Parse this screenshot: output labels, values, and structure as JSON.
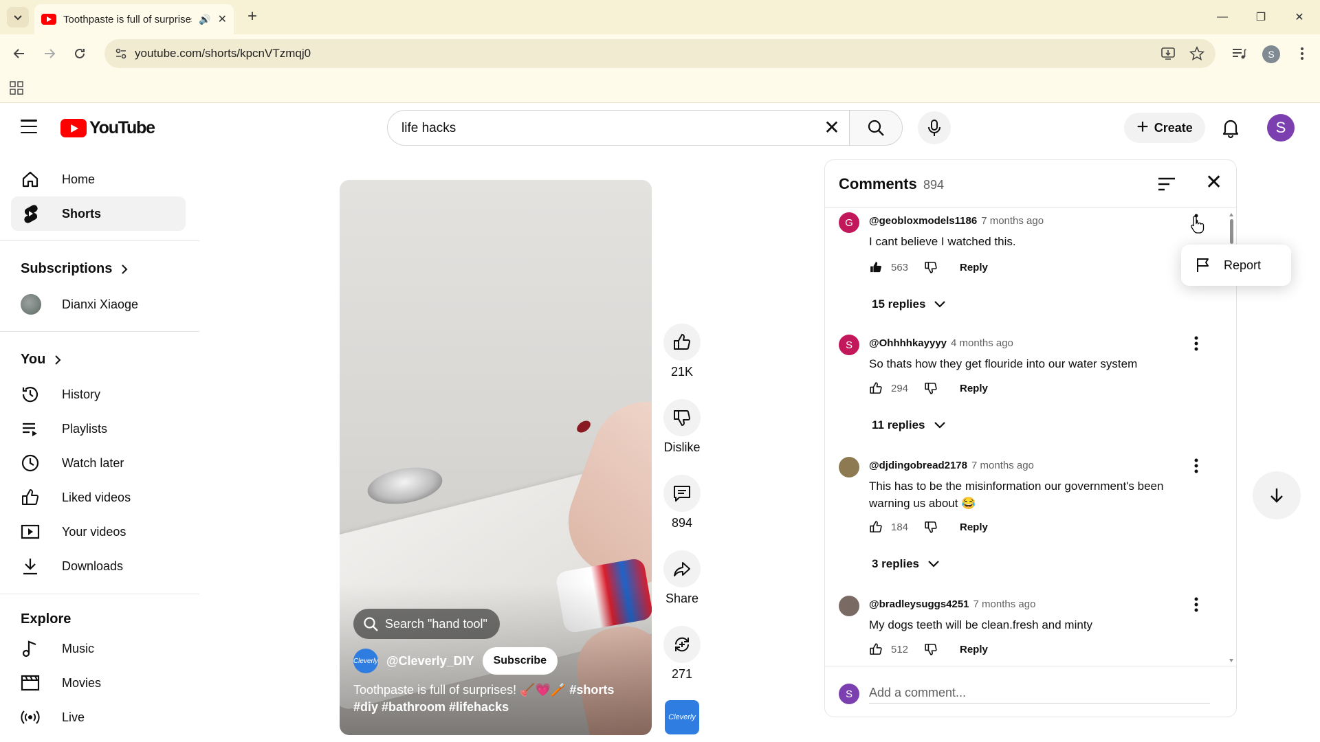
{
  "browser": {
    "tab_title": "Toothpaste is full of surprises",
    "url": "youtube.com/shorts/kpcnVTzmqj0",
    "profile_initial": "S"
  },
  "header": {
    "brand": "YouTube",
    "search_query": "life hacks",
    "create_label": "Create",
    "user_initial": "S"
  },
  "sidebar": {
    "main": [
      {
        "label": "Home",
        "icon": "home-icon"
      },
      {
        "label": "Shorts",
        "icon": "shorts-icon",
        "active": true
      }
    ],
    "subscriptions_heading": "Subscriptions",
    "subscriptions": [
      {
        "label": "Dianxi Xiaoge"
      }
    ],
    "you_heading": "You",
    "you": [
      {
        "label": "History",
        "icon": "history-icon"
      },
      {
        "label": "Playlists",
        "icon": "playlists-icon"
      },
      {
        "label": "Watch later",
        "icon": "clock-icon"
      },
      {
        "label": "Liked videos",
        "icon": "thumbs-up-icon"
      },
      {
        "label": "Your videos",
        "icon": "play-square-icon"
      },
      {
        "label": "Downloads",
        "icon": "download-icon"
      }
    ],
    "explore_heading": "Explore",
    "explore": [
      {
        "label": "Music",
        "icon": "music-note-icon"
      },
      {
        "label": "Movies",
        "icon": "film-icon"
      },
      {
        "label": "Live",
        "icon": "live-icon"
      }
    ]
  },
  "video": {
    "search_chip": "Search \"hand tool\"",
    "channel": "@Cleverly_DIY",
    "channel_logo_text": "Cleverly",
    "subscribe_label": "Subscribe",
    "title": "Toothpaste is full of surprises! 🪠💗🪥",
    "tags_line1": "#shorts",
    "tags_line2": "#diy #bathroom #lifehacks"
  },
  "actions": {
    "likes": "21K",
    "dislike": "Dislike",
    "comments": "894",
    "share": "Share",
    "remix": "271",
    "thumb_text": "Cleverly"
  },
  "comments_panel": {
    "title": "Comments",
    "count": "894",
    "add_placeholder": "Add a comment...",
    "user_initial": "S",
    "reply_label": "Reply",
    "items": [
      {
        "author": "@geobloxmodels1186",
        "time": "7 months ago",
        "text": "I cant believe I watched this.",
        "likes": "563",
        "replies": "15 replies",
        "initial": "G",
        "avatar_color": "#c2185b"
      },
      {
        "author": "@Ohhhhkayyyy",
        "time": "4 months ago",
        "text": "So thats how they get flouride into our water system",
        "likes": "294",
        "replies": "11 replies",
        "initial": "S",
        "avatar_color": "#c2185b"
      },
      {
        "author": "@djdingobread2178",
        "time": "7 months ago",
        "text": "This has to be the misinformation our government's been warning us about 😂",
        "likes": "184",
        "replies": "3 replies",
        "initial": "",
        "avatar_color": "#8d7a52"
      },
      {
        "author": "@bradleysuggs4251",
        "time": "7 months ago",
        "text": "My dogs teeth will be clean.fresh and minty",
        "likes": "512",
        "replies": "",
        "initial": "",
        "avatar_color": "#7a6a64"
      }
    ],
    "menu_report": "Report"
  }
}
